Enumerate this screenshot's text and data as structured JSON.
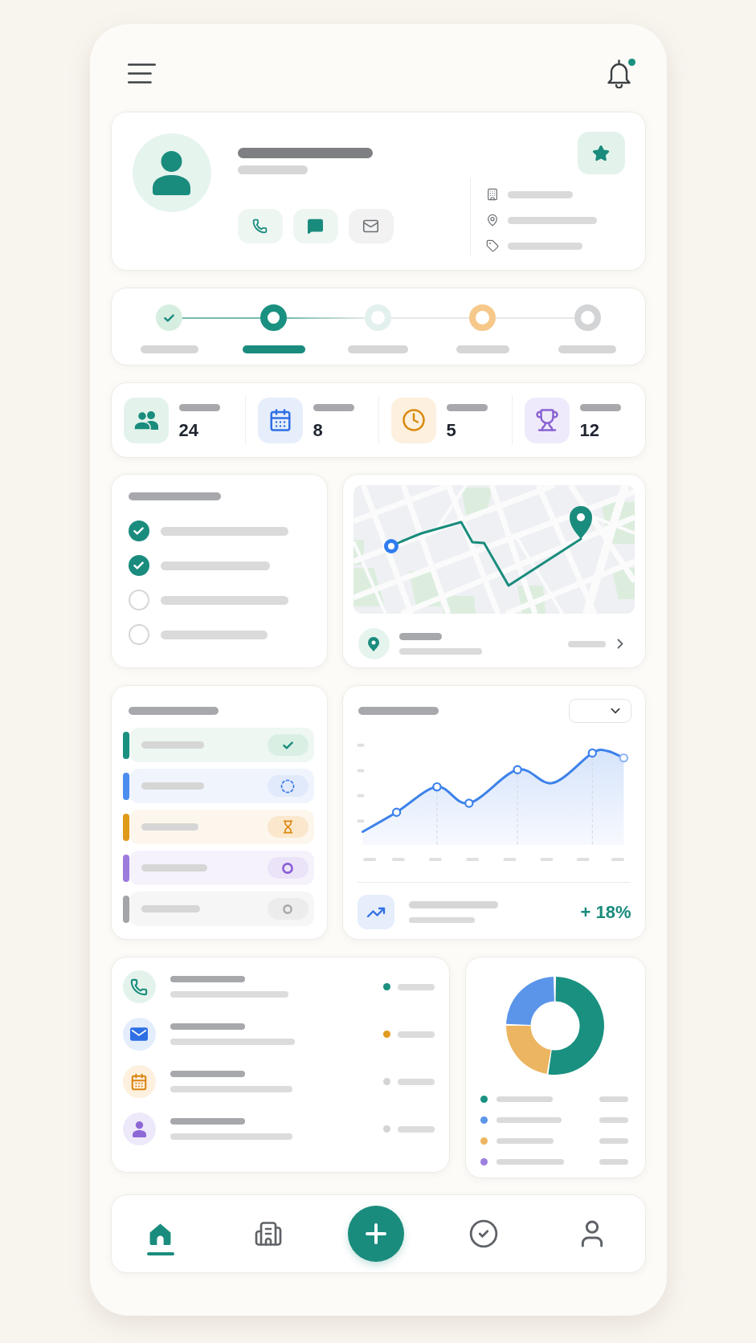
{
  "header": {
    "unread": true
  },
  "profile": {
    "favorite": true
  },
  "steps": [
    {
      "kind": "done",
      "color": "#d6eee0"
    },
    {
      "kind": "current",
      "color": "#1a9080"
    },
    {
      "kind": "upcoming",
      "color": "#e2f0ee"
    },
    {
      "kind": "upcoming",
      "color": "#f6c88a"
    },
    {
      "kind": "upcoming",
      "color": "#d3d4d6"
    }
  ],
  "stats": [
    {
      "kind": "people",
      "value": "24"
    },
    {
      "kind": "calendar",
      "value": "8"
    },
    {
      "kind": "clock",
      "value": "5"
    },
    {
      "kind": "trophy",
      "value": "12"
    }
  ],
  "checklist": [
    {
      "checked": true
    },
    {
      "checked": true
    },
    {
      "checked": false
    },
    {
      "checked": false
    }
  ],
  "tasks": [
    {
      "kind": "done",
      "color": "#1a9080"
    },
    {
      "kind": "in_progress",
      "color": "#4b8ef0"
    },
    {
      "kind": "waiting",
      "color": "#e09a1a"
    },
    {
      "kind": "open",
      "color": "#9c7bdc"
    },
    {
      "kind": "idle",
      "color": "#a3a5a8"
    }
  ],
  "growth": {
    "change": "+ 18%"
  },
  "contacts": [
    {
      "kind": "phone",
      "color": "#1a9080"
    },
    {
      "kind": "mail",
      "color": "#e39b1e"
    },
    {
      "kind": "calendar",
      "color": "#d4d4d6"
    },
    {
      "kind": "person",
      "color": "#d4d4d6"
    }
  ],
  "breakdown": {
    "legend": [
      {
        "color": "#1a9080"
      },
      {
        "color": "#5b95ea"
      },
      {
        "color": "#ebb561"
      },
      {
        "color": "#9c7fdc"
      }
    ]
  },
  "nav": [
    {
      "kind": "home",
      "selected": true
    },
    {
      "kind": "building",
      "selected": false
    },
    {
      "kind": "add",
      "selected": false
    },
    {
      "kind": "check",
      "selected": false
    },
    {
      "kind": "profile",
      "selected": false
    }
  ]
}
